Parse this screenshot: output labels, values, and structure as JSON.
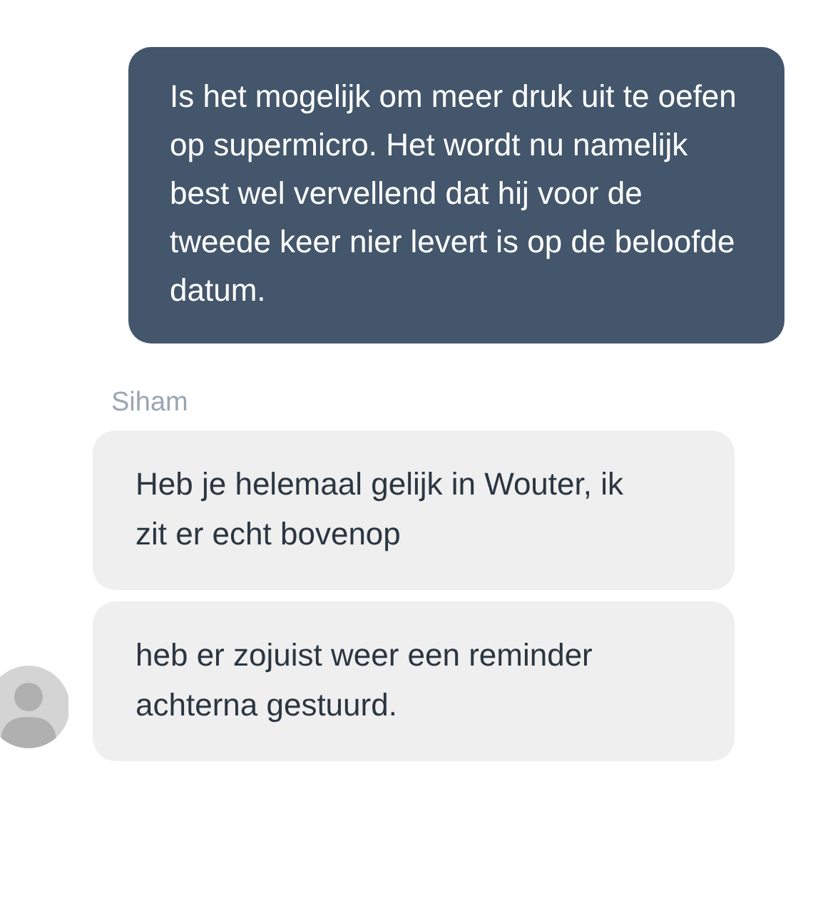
{
  "outgoing": [
    {
      "text": "Is het mogelijk om meer druk uit te oefen op supermicro. Het wordt nu namelijk best wel vervellend dat hij voor de tweede keer nier levert is op de beloofde datum."
    }
  ],
  "incoming_group": {
    "sender": "Siham",
    "messages": [
      {
        "text": "Heb je helemaal gelijk in Wouter, ik zit er echt bovenop"
      },
      {
        "text": "heb er zojuist weer een reminder achterna gestuurd."
      }
    ]
  }
}
